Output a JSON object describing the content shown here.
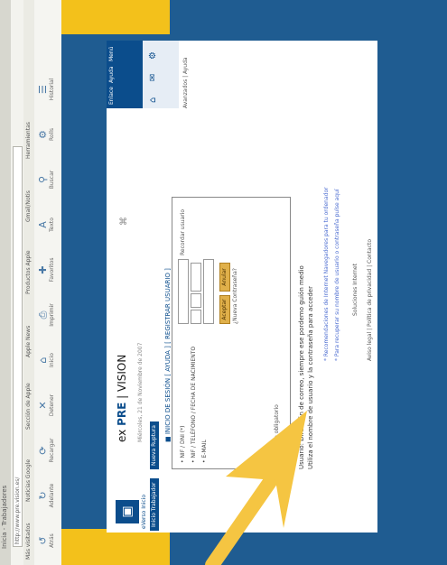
{
  "browser": {
    "title": "Inicia - Trabajadores",
    "address": "http://www.pre.vision.es/",
    "bookmarks": [
      "Más visitados",
      "Noticias Google",
      "Sección de Apple",
      "Apple News",
      "Productos Apple",
      "Gmail/Notis",
      "Herramientas"
    ],
    "toolbar": [
      {
        "label": "Atrás",
        "glyph": "↺"
      },
      {
        "label": "Adelante",
        "glyph": "↻"
      },
      {
        "label": "Recargar",
        "glyph": "⟳"
      },
      {
        "label": "Detener",
        "glyph": "✕"
      },
      {
        "label": "Inicio",
        "glyph": "⌂"
      },
      {
        "label": "Imprimir",
        "glyph": "⎙"
      },
      {
        "label": "Favoritos",
        "glyph": "✚"
      },
      {
        "label": "Texto",
        "glyph": "A"
      },
      {
        "label": "Buscar",
        "glyph": "⚲"
      },
      {
        "label": "Rolls",
        "glyph": "⚙"
      },
      {
        "label": "Historial",
        "glyph": "☰"
      }
    ]
  },
  "page": {
    "logo_text": "eVerso Inicio",
    "nav_tabs": [
      "Inicio Trabajador",
      "Nueva Ruptura"
    ],
    "title_prefix": "ex",
    "title_main": "PRE",
    "title_suffix": "| VISION",
    "subtitle": "Miércoles, 21 de Noviembre de 2007",
    "breadcrumb": "■ INICIO DE SESIÓN [ AYUDA ] [ REGISTRAR USUARIO ]",
    "right_tabs": [
      "Enlace",
      "Ayuda",
      "Menú"
    ],
    "right_icons": [
      "⌂",
      "✉",
      "⚙"
    ],
    "right_links": "Avanzados | Ayuda",
    "form": {
      "label1": "• NIF / DNI (*)",
      "label2": "• NIF / TELÉFONO / FECHA DE NACIMIENTO",
      "label3": "• E-MAIL",
      "accept": "Aceptar",
      "cancel": "Anular",
      "forgot": "¿Nueva Contraseña?",
      "remember": "Recordar usuario",
      "required": "(*) Campo obligatorio"
    },
    "message": "Usuario: Dirección de correo, siempre ese pordemo guión medio",
    "message2": "Utiliza el nombre de usuario y la contraseña para acceder",
    "links": [
      "* Recomendaciones de Internet Navegadores para tu ordenador",
      "* Para recuperar su nombre de usuario o contraseña pulse aquí"
    ],
    "footer": "Soluciones Internet",
    "footer_links": "Aviso legal | Política de privacidad | Contacto"
  },
  "colors": {
    "primary": "#0b4d8c",
    "accent": "#f3c11b",
    "arrow": "#f5c542"
  }
}
